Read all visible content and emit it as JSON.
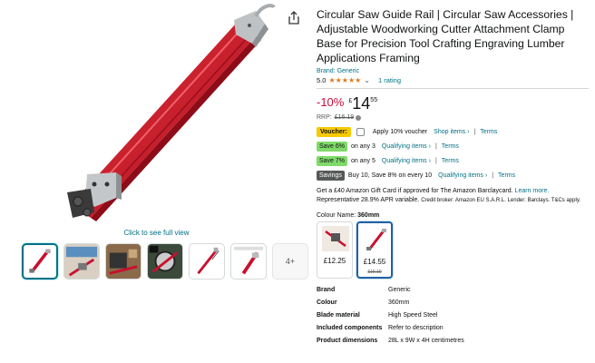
{
  "gallery": {
    "full_view_label": "Click to see full view",
    "more_label": "4+",
    "thumbnail_count": 6
  },
  "product": {
    "title": "Circular Saw Guide Rail | Circular Saw Accessories | Adjustable Woodworking Cutter Attachment Clamp Base for Precision Tool Crafting Engraving Lumber Applications Framing",
    "brand_link": "Brand: Generic",
    "rating_value": "5.0",
    "stars": "★★★★★",
    "rating_chevron": "⌄",
    "rating_count": "1 rating",
    "rating_out_of_5": 5.0
  },
  "price": {
    "discount": "-10%",
    "currency": "£",
    "whole": "14",
    "fraction": "55",
    "rrp_label": "RRP:",
    "rrp_value": "£16.19"
  },
  "promotions": {
    "voucher_badge": "Voucher:",
    "voucher_text": "Apply 10% voucher",
    "shop_items": "Shop items ›",
    "terms": "Terms",
    "sep": "|",
    "save6_badge": "Save 6%",
    "save6_text": "on any 3",
    "qualifying_items": "Qualifying items ›",
    "save7_badge": "Save 7%",
    "save7_text": "on any 5",
    "savings_badge": "Savings",
    "savings_text": "Buy 10, Save 8% on every 10"
  },
  "card_offer": {
    "text": "Get a £40 Amazon Gift Card if approved for The Amazon Barclaycard.",
    "learn_more": "Learn more.",
    "apr": "Representative 28.9% APR variable.",
    "broker": "Credit broker: Amazon EU S.A.R.L. Lender: Barclays. T&Cs apply."
  },
  "colour": {
    "label": "Colour Name:",
    "selected": "360mm",
    "options": [
      {
        "price": "£12.25",
        "rrp": ""
      },
      {
        "price": "£14.55",
        "rrp": "£16.19"
      }
    ]
  },
  "specs": [
    {
      "key": "Brand",
      "value": "Generic"
    },
    {
      "key": "Colour",
      "value": "360mm"
    },
    {
      "key": "Blade material",
      "value": "High Speed Steel"
    },
    {
      "key": "Included components",
      "value": "Refer to description"
    },
    {
      "key": "Product dimensions",
      "value": "28L x 9W x 4H centimetres"
    }
  ],
  "colors": {
    "link": "#007185",
    "deal_red": "#cc0c39",
    "star": "#de7921",
    "rail_red": "#c8102e",
    "voucher_yellow": "#f7ca00",
    "save_green": "#7fda69",
    "selected_blue": "#2162a1"
  },
  "icons": {
    "share": "share-icon",
    "info": "info-icon",
    "chevron": "chevron-down-icon"
  }
}
